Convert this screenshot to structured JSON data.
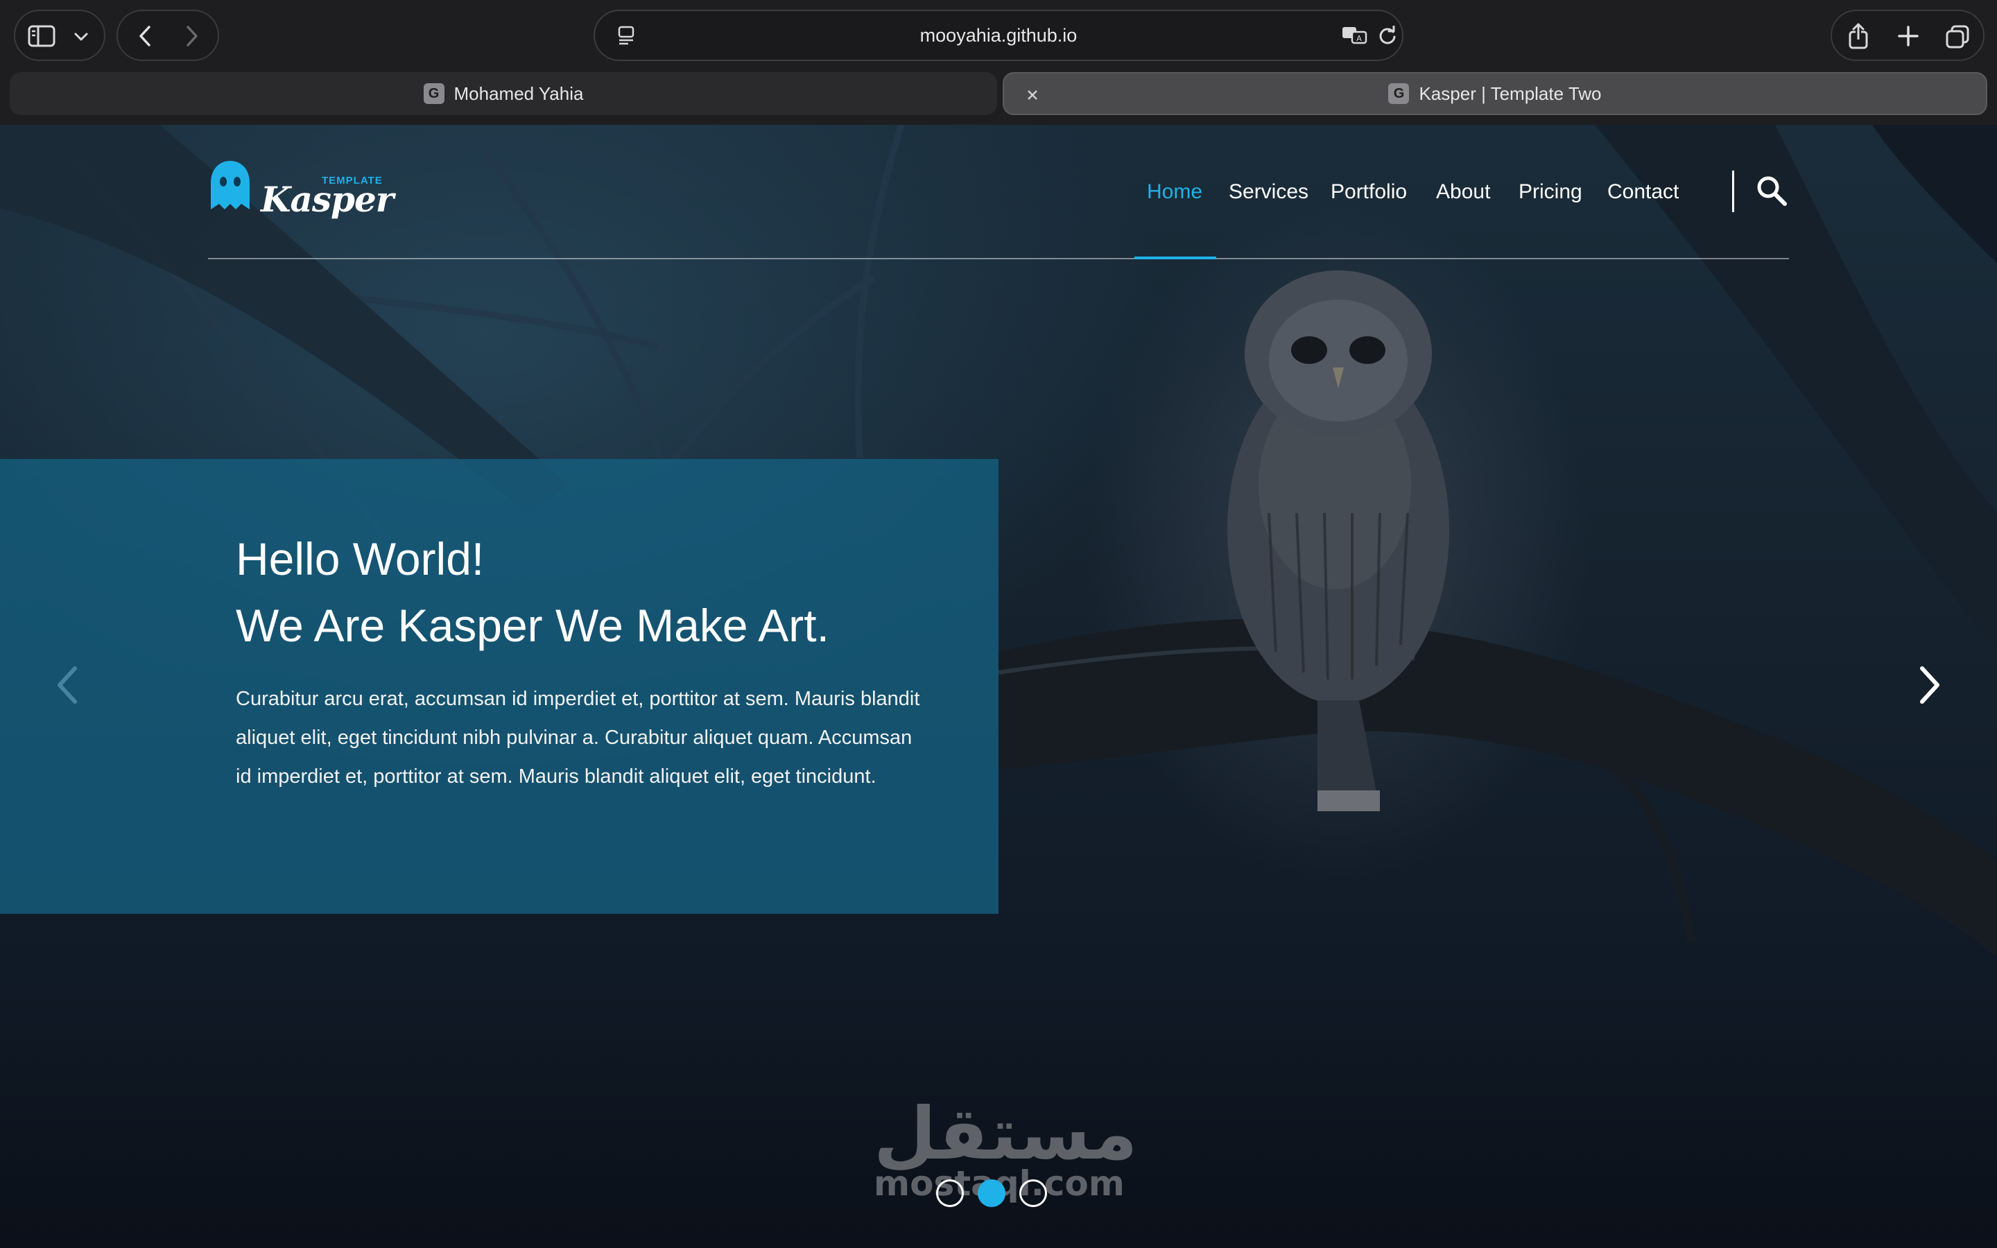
{
  "browser": {
    "url": "mooyahia.github.io",
    "tabs": [
      {
        "label": "Mohamed Yahia",
        "favicon": "G"
      },
      {
        "label": "Kasper | Template Two",
        "favicon": "G"
      }
    ],
    "icons": [
      "sidebar-icon",
      "chevron-down-icon",
      "back-icon",
      "forward-icon",
      "reader-icon",
      "translate-icon",
      "reload-icon",
      "share-icon",
      "new-tab-icon",
      "tab-overview-icon",
      "close-icon"
    ]
  },
  "site": {
    "logo": {
      "small": "TEMPLATE",
      "word": "Kasper"
    },
    "nav": {
      "items": [
        "Home",
        "Services",
        "Portfolio",
        "About",
        "Pricing",
        "Contact"
      ],
      "active": "Home"
    },
    "hero": {
      "title_line1": "Hello World!",
      "title_line2": "We Are Kasper We Make Art.",
      "paragraph": "Curabitur arcu erat, accumsan id imperdiet et, porttitor at sem. Mauris blandit aliquet elit, eget tincidunt nibh pulvinar a. Curabitur aliquet quam. Accumsan id imperdiet et, porttitor at sem. Mauris blandit aliquet elit, eget tincidunt."
    },
    "slider": {
      "total": 3,
      "active_index": 2
    }
  },
  "watermark": {
    "arabic": "مستقل",
    "latin": "mostaql.com"
  },
  "colors": {
    "accent": "#1fb2e8",
    "panel": "#146082",
    "chrome": "#1e1e20"
  }
}
